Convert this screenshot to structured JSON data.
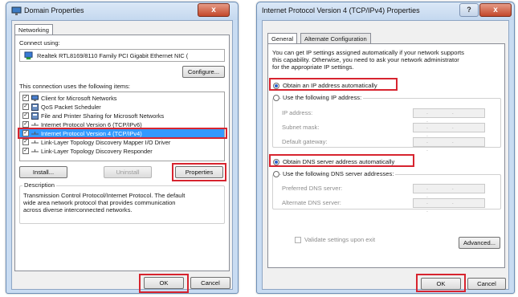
{
  "left": {
    "title": "Domain Properties",
    "close": "x",
    "tab": "Networking",
    "connect_using": "Connect using:",
    "adapter": "Realtek RTL8169/8110 Family PCI Gigabit Ethernet NIC (",
    "configure": "Configure...",
    "items_label": "This connection uses the following items:",
    "items": [
      {
        "label": "Client for Microsoft Networks",
        "checked": true,
        "icon": "network-client-icon"
      },
      {
        "label": "QoS Packet Scheduler",
        "checked": true,
        "icon": "service-icon"
      },
      {
        "label": "File and Printer Sharing for Microsoft Networks",
        "checked": true,
        "icon": "service-icon"
      },
      {
        "label": "Internet Protocol Version 6 (TCP/IPv6)",
        "checked": true,
        "icon": "protocol-icon"
      },
      {
        "label": "Internet Protocol Version 4 (TCP/IPv4)",
        "checked": true,
        "icon": "protocol-icon",
        "selected": true
      },
      {
        "label": "Link-Layer Topology Discovery Mapper I/O Driver",
        "checked": true,
        "icon": "protocol-icon"
      },
      {
        "label": "Link-Layer Topology Discovery Responder",
        "checked": true,
        "icon": "protocol-icon"
      }
    ],
    "install": "Install...",
    "uninstall": "Uninstall",
    "properties": "Properties",
    "description_label": "Description",
    "description": [
      "Transmission Control Protocol/Internet Protocol. The default",
      "wide area network protocol that provides communication",
      "across diverse interconnected networks."
    ],
    "ok": "OK",
    "cancel": "Cancel"
  },
  "right": {
    "title": "Internet Protocol Version 4 (TCP/IPv4) Properties",
    "help": "?",
    "close": "x",
    "tabs": [
      "General",
      "Alternate Configuration"
    ],
    "intro": [
      "You can get IP settings assigned automatically if your network supports",
      "this capability. Otherwise, you need to ask your network administrator",
      "for the appropriate IP settings."
    ],
    "obtain_ip": "Obtain an IP address automatically",
    "use_ip": "Use the following IP address:",
    "ip_address": "IP address:",
    "subnet_mask": "Subnet mask:",
    "default_gateway": "Default gateway:",
    "ip_dots": ". . .",
    "obtain_dns": "Obtain DNS server address automatically",
    "use_dns": "Use the following DNS server addresses:",
    "preferred_dns": "Preferred DNS server:",
    "alternate_dns": "Alternate DNS server:",
    "validate": "Validate settings upon exit",
    "advanced": "Advanced...",
    "ok": "OK",
    "cancel": "Cancel"
  },
  "colors": {
    "highlight": "#d7242f",
    "selection": "#3399ff",
    "chrome": "#c9dcf2"
  }
}
